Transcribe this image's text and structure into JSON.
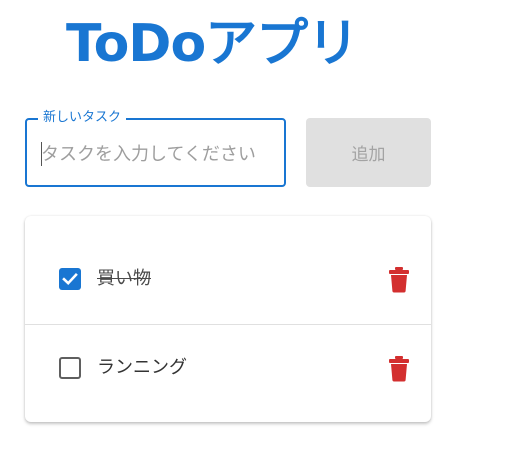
{
  "app": {
    "title": "ToDoアプリ"
  },
  "form": {
    "field_label": "新しいタスク",
    "input_value": "",
    "input_placeholder": "タスクを入力してください",
    "add_label": "追加"
  },
  "todos": [
    {
      "label": "買い物",
      "completed": true
    },
    {
      "label": "ランニング",
      "completed": false
    }
  ],
  "colors": {
    "primary": "#1976d2",
    "delete": "#d32f2f",
    "disabled_bg": "#e0e0e0",
    "disabled_text": "#a3a3a3"
  },
  "icons": {
    "checkbox_checked": "checkbox-checked-icon",
    "checkbox_unchecked": "checkbox-unchecked-icon",
    "delete": "trash-icon"
  }
}
